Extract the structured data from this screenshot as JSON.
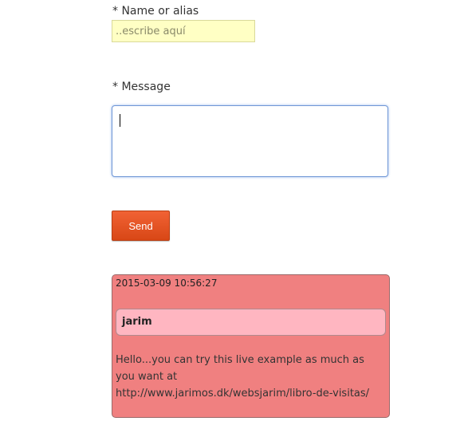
{
  "form": {
    "name_label": "* Name or alias",
    "name_placeholder": "..escribe aquí",
    "name_value": "",
    "message_label": "* Message",
    "message_value": "",
    "send_label": "Send"
  },
  "entries": [
    {
      "timestamp": "2015-03-09 10:56:27",
      "author": "jarim",
      "message": "Hello...you can try this live example as much as you want  at http://www.jarimos.dk/websjarim/libro-de-visitas/"
    }
  ],
  "colors": {
    "name_input_bg": "#ffffc4",
    "send_button": "#e2522a",
    "entry_card_bg": "#f08080",
    "entry_author_bg": "#ffb6c1"
  }
}
